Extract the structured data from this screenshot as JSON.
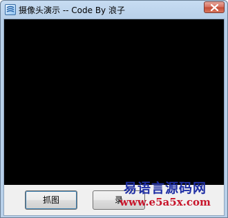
{
  "window": {
    "title": "摄像头演示 -- Code By 浪子"
  },
  "buttons": {
    "capture_label": "抓图",
    "record_label": "录"
  },
  "watermark": {
    "name": "易语言源码网",
    "url": "www.e5a5x.com"
  },
  "icons": {
    "app": "app-icon",
    "close": "close-icon"
  },
  "colors": {
    "video_background": "#000000",
    "watermark_title": "#1f2fa5",
    "watermark_url": "#c8142a"
  }
}
